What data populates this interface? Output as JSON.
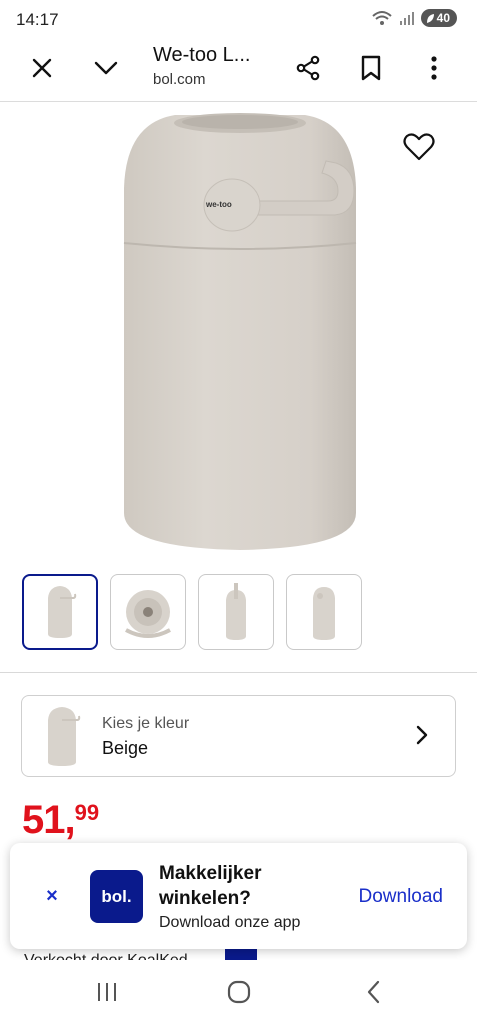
{
  "status": {
    "time": "14:17",
    "battery": "40"
  },
  "toolbar": {
    "title": "We-too L...",
    "url": "bol.com",
    "icons": [
      "close-icon",
      "chevron-down-icon",
      "share-icon",
      "bookmark-icon",
      "more-vert-icon"
    ]
  },
  "product": {
    "image_logo_text": "we-too",
    "favorite_icon": "heart-outline-icon",
    "thumbnails": [
      {
        "name": "front view",
        "selected": true
      },
      {
        "name": "top view",
        "selected": false
      },
      {
        "name": "side view",
        "selected": false
      },
      {
        "name": "angle view",
        "selected": false
      }
    ]
  },
  "color_selector": {
    "label": "Kies je kleur",
    "value": "Beige"
  },
  "price": {
    "main": "51,",
    "cents": "99"
  },
  "partial_text": "Verkocht door KoalKed",
  "app_banner": {
    "logo": "bol.",
    "title": "Makkelijker winkelen?",
    "subtitle": "Download onze app",
    "action": "Download",
    "close": "×"
  },
  "colors": {
    "accent": "#0a1a8c",
    "link": "#1a2fc9",
    "price": "#e0121c",
    "product": "#d8d3cc"
  }
}
